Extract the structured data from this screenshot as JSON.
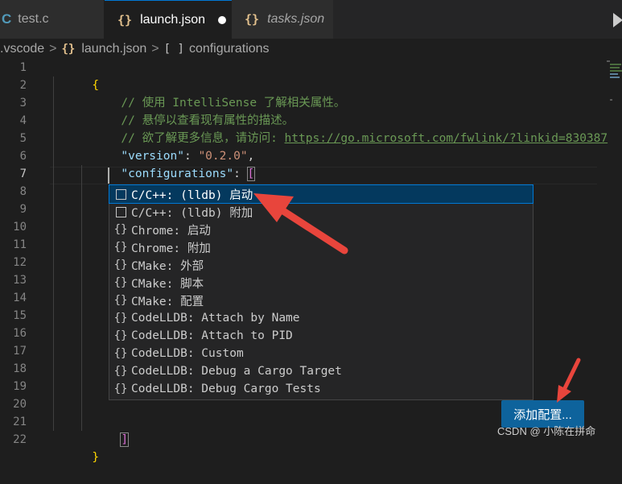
{
  "tabs": [
    {
      "icon": "C",
      "label": "test.c"
    },
    {
      "icon": "{}",
      "label": "launch.json",
      "dirty": true
    },
    {
      "icon": "{}",
      "label": "tasks.json"
    }
  ],
  "breadcrumb": {
    "folder": ".vscode",
    "file_icon": "{}",
    "file": "launch.json",
    "symbol_icon": "[ ]",
    "symbol": "configurations",
    "separator": ">"
  },
  "editor": {
    "line_numbers": [
      "1",
      "2",
      "3",
      "4",
      "5",
      "6",
      "7",
      "8",
      "9",
      "10",
      "11",
      "12",
      "13",
      "14",
      "15",
      "16",
      "17",
      "18",
      "19",
      "20",
      "21",
      "22"
    ],
    "lines": {
      "l1": "{",
      "l2": "// 使用 IntelliSense 了解相关属性。",
      "l3": "// 悬停以查看现有属性的描述。",
      "l4_prefix": "// 欲了解更多信息，请访问: ",
      "l4_link": "https://go.microsoft.com/fwlink/?linkid=830387",
      "l5_key": "\"version\"",
      "l5_colon": ": ",
      "l5_value": "\"0.2.0\"",
      "l5_comma": ",",
      "l6_key": "\"configurations\"",
      "l6_colon": ": ",
      "l6_bracket": "[",
      "l21_bracket": "]",
      "l22": "}"
    }
  },
  "suggestions": [
    {
      "icon": "square",
      "label": "C/C++: (lldb) 启动",
      "selected": true
    },
    {
      "icon": "square",
      "label": "C/C++: (lldb) 附加"
    },
    {
      "icon": "braces",
      "label": "Chrome: 启动"
    },
    {
      "icon": "braces",
      "label": "Chrome: 附加"
    },
    {
      "icon": "braces",
      "label": "CMake: 外部"
    },
    {
      "icon": "braces",
      "label": "CMake: 脚本"
    },
    {
      "icon": "braces",
      "label": "CMake: 配置"
    },
    {
      "icon": "braces",
      "label": "CodeLLDB: Attach by Name"
    },
    {
      "icon": "braces",
      "label": "CodeLLDB: Attach to PID"
    },
    {
      "icon": "braces",
      "label": "CodeLLDB: Custom"
    },
    {
      "icon": "braces",
      "label": "CodeLLDB: Debug a Cargo Target"
    },
    {
      "icon": "braces",
      "label": "CodeLLDB: Debug Cargo Tests"
    }
  ],
  "add_config_button": "添加配置...",
  "watermark": "CSDN @ 小陈在拼命",
  "colors": {
    "accent": "#0078d4",
    "button": "#0e639c",
    "arrow": "#e8453c",
    "comment": "#6a9955",
    "key": "#9cdcfe",
    "string": "#ce9178"
  }
}
